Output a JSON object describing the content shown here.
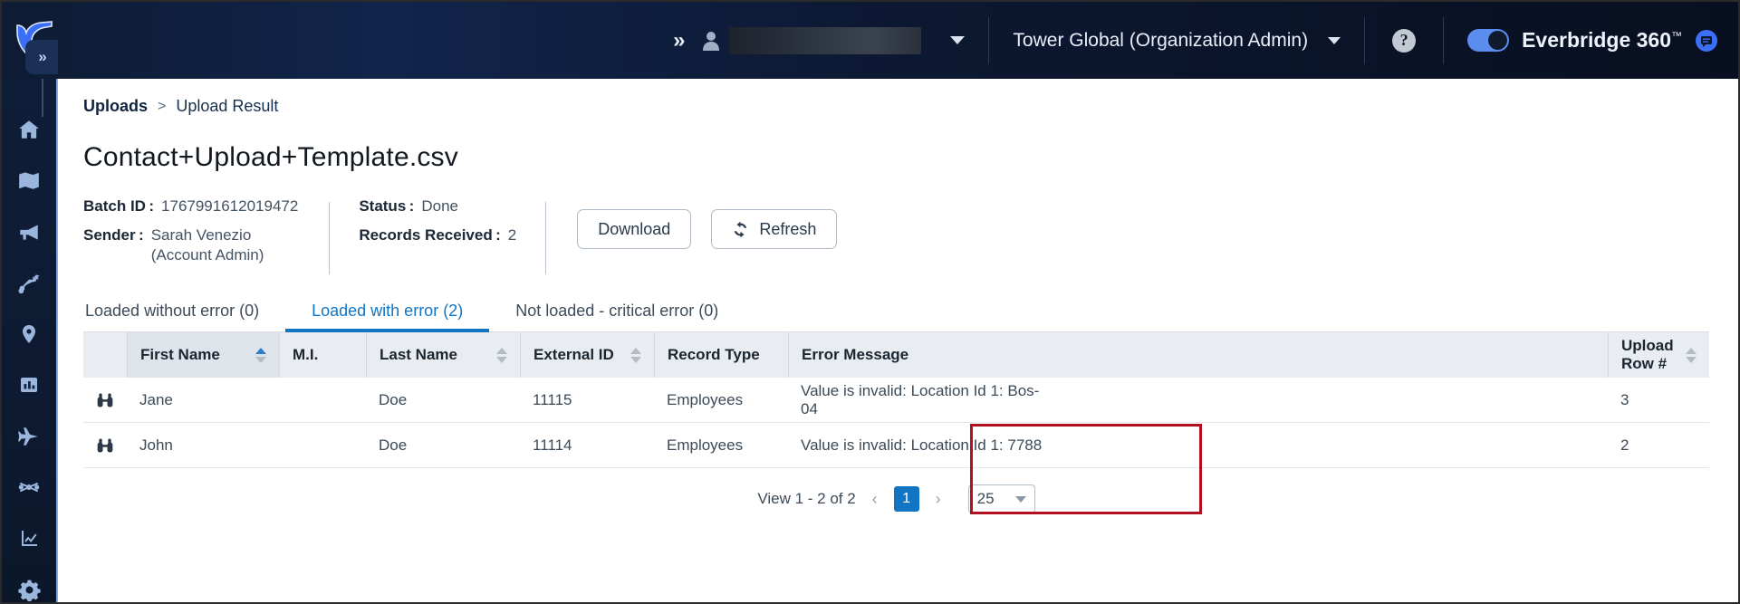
{
  "topbar": {
    "expand_label": "»",
    "user_value": "",
    "org_label": "Tower Global (Organization Admin)",
    "help_label": "?",
    "brand_label": "Everbridge 360",
    "brand_tm": "™",
    "toggle_state": "on"
  },
  "sidebar": {
    "collapse_label": "»",
    "items": [
      {
        "name": "home-icon"
      },
      {
        "name": "map-icon"
      },
      {
        "name": "megaphone-icon"
      },
      {
        "name": "workflow-icon"
      },
      {
        "name": "location-pin-icon"
      },
      {
        "name": "bar-chart-icon"
      },
      {
        "name": "airplane-icon"
      },
      {
        "name": "network-icon"
      },
      {
        "name": "analytics-icon"
      },
      {
        "name": "settings-gear-icon"
      }
    ]
  },
  "breadcrumb": {
    "first": "Uploads",
    "separator": ">",
    "current": "Upload Result"
  },
  "page_title": "Contact+Upload+Template.csv",
  "meta": {
    "batch_id_label": "Batch ID :",
    "batch_id_value": "1767991612019472",
    "sender_label": "Sender :",
    "sender_value": "Sarah Venezio (Account Admin)",
    "status_label": "Status :",
    "status_value": "Done",
    "records_label": "Records Received :",
    "records_value": "2"
  },
  "buttons": {
    "download": "Download",
    "refresh": "Refresh",
    "refresh_icon": "↻"
  },
  "tabs": [
    {
      "label": "Loaded without error (0)",
      "active": false
    },
    {
      "label": "Loaded with error (2)",
      "active": true
    },
    {
      "label": "Not loaded - critical error (0)",
      "active": false
    }
  ],
  "table": {
    "headers": {
      "first_name": "First Name",
      "mi": "M.I.",
      "last_name": "Last Name",
      "external_id": "External ID",
      "record_type": "Record Type",
      "error_message": "Error Message",
      "upload_row": "Upload Row #"
    },
    "rows": [
      {
        "icon": "binoculars-icon",
        "first_name": "Jane",
        "mi": "",
        "last_name": "Doe",
        "external_id": "11115",
        "record_type": "Employees",
        "error_message": "Value is invalid: Location Id 1: Bos-04",
        "upload_row": "3"
      },
      {
        "icon": "binoculars-icon",
        "first_name": "John",
        "mi": "",
        "last_name": "Doe",
        "external_id": "11114",
        "record_type": "Employees",
        "error_message": "Value is invalid: Location Id 1: 7788",
        "upload_row": "2"
      }
    ]
  },
  "pagination": {
    "summary": "View 1 - 2 of 2",
    "prev": "‹",
    "page": "1",
    "next": "›",
    "page_size": "25"
  },
  "colors": {
    "accent_blue": "#1275c4",
    "header_navy": "#0d1b33",
    "error_red": "#b01020"
  }
}
